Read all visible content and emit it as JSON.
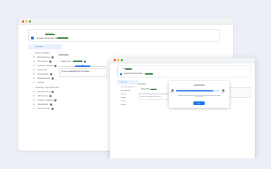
{
  "colors": {
    "background": "#eceff7",
    "accent": "#1a73e8",
    "redacted_green": "#2f7d32",
    "active_nav_bg": "#e8f0fe"
  },
  "back_window": {
    "account_small_label": "Account",
    "account_name": "Google Cloud Test Name",
    "sidebar": {
      "active_item": "Summary",
      "groups": [
        {
          "label": "Source - Realtime",
          "items": [
            "Manage Access",
            "VPN Service",
            "Customer Gateway",
            "Cloud Links",
            "Subscriptions",
            "Network Config",
            "Settings"
          ]
        },
        {
          "label": "Cloud App - App Interconnect",
          "items": [
            "Manage Access",
            "VPN Service",
            "Customer Gateway",
            "Subscriptions",
            "Network Config"
          ]
        }
      ]
    },
    "main": {
      "title": "Summary",
      "cloud_label": "Cloud VCP",
      "tab_marker": "Apr",
      "assignment_text": "No vpc cloud assigned for this instance"
    }
  },
  "front_window": {
    "account_small_label": "Acc",
    "account_name": "Google Cloud Test Name",
    "sidebar_items": [
      "Summary",
      "Cloud Links Anywhere",
      "Source Access",
      "Gateway",
      "Firewall",
      "Routing",
      "Settings"
    ],
    "main_title": "Overview",
    "cloud_label": "Cloud VCP",
    "box_text": "No vpc cloud assigned for this instance",
    "dialog": {
      "title": "Connected",
      "left_endpoint": "Source",
      "right_endpoint": "Google",
      "progress": 0.85,
      "message": "Connection has been established successfully. Traffic from your source network is routed to the cloud instance.",
      "button_label": "Done"
    }
  }
}
